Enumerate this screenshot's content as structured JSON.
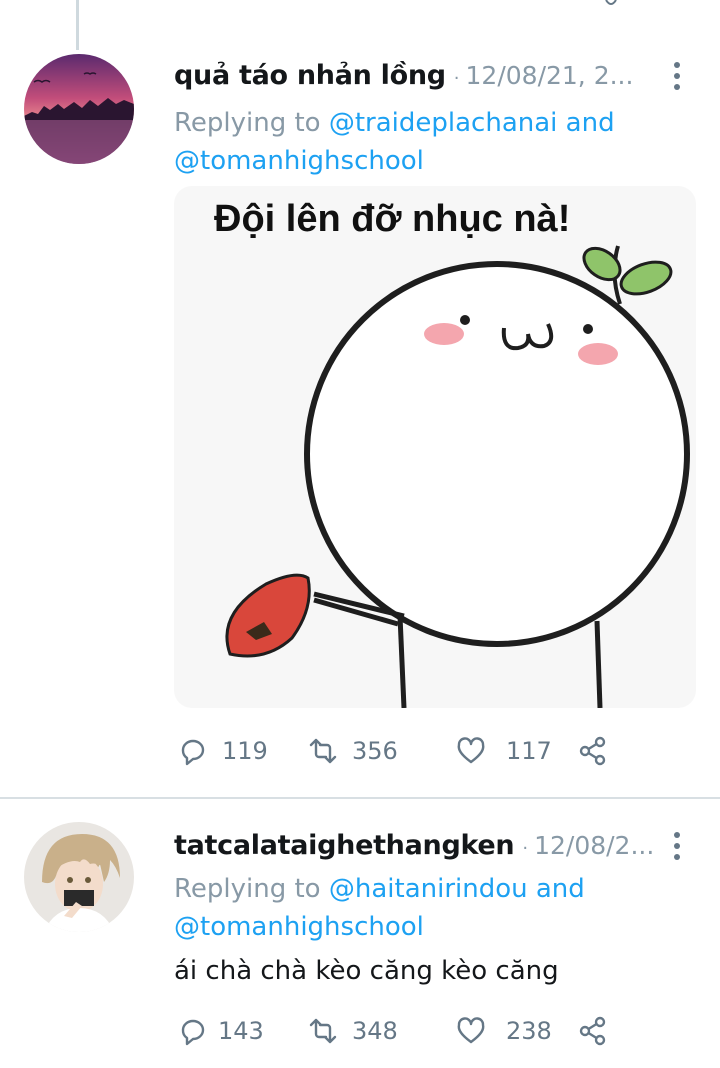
{
  "tweets": [
    {
      "name": "quả táo nhản lồng",
      "separator": "·",
      "date": "12/08/21, 2...",
      "replying": {
        "prefix": "Replying to",
        "user1": "@traideplachanai",
        "and": "and",
        "user2": "@tomanhighschool"
      },
      "meme_caption": "Đội lên đỡ nhục nà!",
      "stats": {
        "replies": "119",
        "retweets": "356",
        "likes": "117"
      }
    },
    {
      "name": "tatcalataighethangken",
      "separator": "·",
      "date": "12/08/2...",
      "replying": {
        "prefix": "Replying to",
        "user1": "@haitanirindou",
        "and": "and",
        "user2": "@tomanhighschool"
      },
      "text": "ái chà chà kèo căng kèo căng",
      "stats": {
        "replies": "143",
        "retweets": "348",
        "likes": "238"
      }
    }
  ],
  "colors": {
    "link": "#1da1f2",
    "muted": "#8899a6",
    "text": "#14171a",
    "divider": "#d8dfe3"
  },
  "icons": [
    "reply-icon",
    "retweet-icon",
    "like-icon",
    "share-icon",
    "more-options-icon"
  ]
}
